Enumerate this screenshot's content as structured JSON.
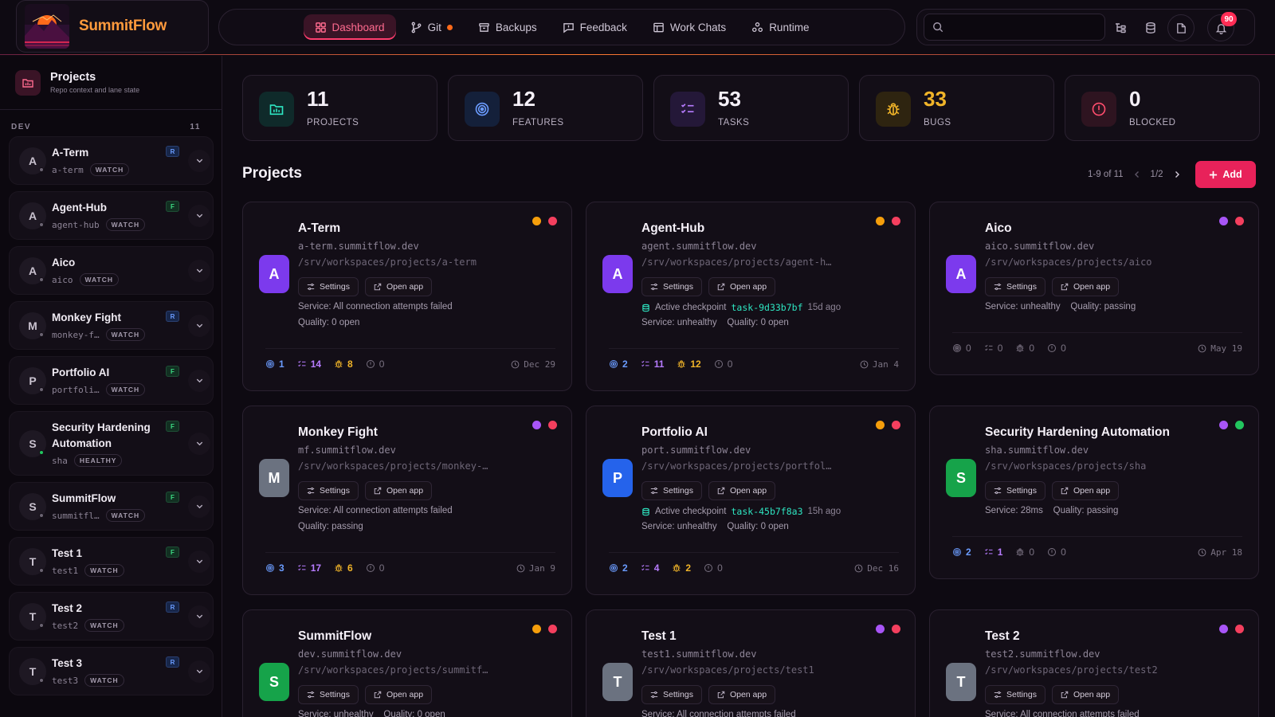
{
  "brand": {
    "name": "SummitFlow"
  },
  "nav": [
    {
      "label": "Dashboard",
      "icon": "grid-icon",
      "active": true
    },
    {
      "label": "Git",
      "icon": "git-branch-icon",
      "indicator": true
    },
    {
      "label": "Backups",
      "icon": "archive-icon"
    },
    {
      "label": "Feedback",
      "icon": "feedback-icon"
    },
    {
      "label": "Work Chats",
      "icon": "table-icon"
    },
    {
      "label": "Runtime",
      "icon": "runtime-icon"
    }
  ],
  "search": {
    "placeholder": ""
  },
  "notifications": {
    "count": "90"
  },
  "sidebar": {
    "title": "Projects",
    "subtitle": "Repo context and lane state",
    "section": {
      "label": "DEV",
      "count": "11"
    },
    "items": [
      {
        "initial": "A",
        "name": "A-Term",
        "slug": "a-term",
        "status": "WATCH",
        "lane": "R",
        "healthy": false
      },
      {
        "initial": "A",
        "name": "Agent-Hub",
        "slug": "agent-hub",
        "status": "WATCH",
        "lane": "F",
        "healthy": false
      },
      {
        "initial": "A",
        "name": "Aico",
        "slug": "aico",
        "status": "WATCH",
        "lane": "",
        "healthy": false
      },
      {
        "initial": "M",
        "name": "Monkey Fight",
        "slug": "monkey-f…",
        "status": "WATCH",
        "lane": "R",
        "healthy": false
      },
      {
        "initial": "P",
        "name": "Portfolio AI",
        "slug": "portfoli…",
        "status": "WATCH",
        "lane": "F",
        "healthy": false
      },
      {
        "initial": "S",
        "name": "Security Hardening Automation",
        "slug": "sha",
        "status": "HEALTHY",
        "lane": "F",
        "healthy": true
      },
      {
        "initial": "S",
        "name": "SummitFlow",
        "slug": "summitfl…",
        "status": "WATCH",
        "lane": "F",
        "healthy": false
      },
      {
        "initial": "T",
        "name": "Test 1",
        "slug": "test1",
        "status": "WATCH",
        "lane": "F",
        "healthy": false
      },
      {
        "initial": "T",
        "name": "Test 2",
        "slug": "test2",
        "status": "WATCH",
        "lane": "R",
        "healthy": false
      },
      {
        "initial": "T",
        "name": "Test 3",
        "slug": "test3",
        "status": "WATCH",
        "lane": "R",
        "healthy": false
      }
    ]
  },
  "stats": [
    {
      "value": "11",
      "label": "PROJECTS",
      "icon": "projects-icon",
      "color": "#2ee6c2",
      "bg": "#0f2a2a"
    },
    {
      "value": "12",
      "label": "FEATURES",
      "icon": "target-icon",
      "color": "#6b9cff",
      "bg": "#14203a"
    },
    {
      "value": "53",
      "label": "TASKS",
      "icon": "checklist-icon",
      "color": "#b77cff",
      "bg": "#241838"
    },
    {
      "value": "33",
      "label": "BUGS",
      "icon": "bug-icon",
      "color": "#f0b429",
      "bg": "#2e2410",
      "valueColor": "#f0b429"
    },
    {
      "value": "0",
      "label": "BLOCKED",
      "icon": "alert-icon",
      "color": "#ff4d6d",
      "bg": "#2e1420"
    }
  ],
  "projects_section": {
    "title": "Projects",
    "range": "1-9 of 11",
    "page": "1/2",
    "add_label": "Add"
  },
  "projects": [
    {
      "name": "A-Term",
      "initial": "A",
      "avatar": "#7c3aed",
      "domain": "a-term.summitflow.dev",
      "path": "/srv/workspaces/projects/a-term",
      "line1": "Service: All connection attempts failed",
      "line2": "Quality: 0 open",
      "features": "1",
      "tasks": "14",
      "bugs": "8",
      "blocked": "0",
      "date": "Dec 29",
      "dots": [
        "#f59e0b",
        "#f43f5e"
      ]
    },
    {
      "name": "Agent-Hub",
      "initial": "A",
      "avatar": "#7c3aed",
      "domain": "agent.summitflow.dev",
      "path": "/srv/workspaces/projects/agent-h…",
      "checkpoint": {
        "label": "Active checkpoint",
        "id": "task-9d33b7bf",
        "age": "15d ago"
      },
      "line2": "Service: unhealthy    Quality: 0 open",
      "features": "2",
      "tasks": "11",
      "bugs": "12",
      "blocked": "0",
      "date": "Jan 4",
      "dots": [
        "#f59e0b",
        "#f43f5e"
      ]
    },
    {
      "name": "Aico",
      "initial": "A",
      "avatar": "#7c3aed",
      "domain": "aico.summitflow.dev",
      "path": "/srv/workspaces/projects/aico",
      "line1": "Service: unhealthy    Quality: passing",
      "features": "0",
      "tasks": "0",
      "bugs": "0",
      "blocked": "0",
      "date": "May 19",
      "dots": [
        "#a855f7",
        "#f43f5e"
      ]
    },
    {
      "name": "Monkey Fight",
      "initial": "M",
      "avatar": "#6b7280",
      "domain": "mf.summitflow.dev",
      "path": "/srv/workspaces/projects/monkey-…",
      "line1": "Service: All connection attempts failed",
      "line2": "Quality: passing",
      "features": "3",
      "tasks": "17",
      "bugs": "6",
      "blocked": "0",
      "date": "Jan 9",
      "dots": [
        "#a855f7",
        "#f43f5e"
      ]
    },
    {
      "name": "Portfolio AI",
      "initial": "P",
      "avatar": "#2563eb",
      "domain": "port.summitflow.dev",
      "path": "/srv/workspaces/projects/portfol…",
      "checkpoint": {
        "label": "Active checkpoint",
        "id": "task-45b7f8a3",
        "age": "15h ago"
      },
      "line2": "Service: unhealthy    Quality: 0 open",
      "features": "2",
      "tasks": "4",
      "bugs": "2",
      "blocked": "0",
      "date": "Dec 16",
      "dots": [
        "#f59e0b",
        "#f43f5e"
      ]
    },
    {
      "name": "Security Hardening Automation",
      "initial": "S",
      "avatar": "#16a34a",
      "domain": "sha.summitflow.dev",
      "path": "/srv/workspaces/projects/sha",
      "line1": "Service: 28ms    Quality: passing",
      "features": "2",
      "tasks": "1",
      "bugs": "0",
      "blocked": "0",
      "date": "Apr 18",
      "dots": [
        "#a855f7",
        "#22c55e"
      ]
    },
    {
      "name": "SummitFlow",
      "initial": "S",
      "avatar": "#16a34a",
      "domain": "dev.summitflow.dev",
      "path": "/srv/workspaces/projects/summitf…",
      "line1": "Service: unhealthy    Quality: 0 open",
      "dots": [
        "#f59e0b",
        "#f43f5e"
      ]
    },
    {
      "name": "Test 1",
      "initial": "T",
      "avatar": "#6b7280",
      "domain": "test1.summitflow.dev",
      "path": "/srv/workspaces/projects/test1",
      "line1": "Service: All connection attempts failed",
      "dots": [
        "#a855f7",
        "#f43f5e"
      ]
    },
    {
      "name": "Test 2",
      "initial": "T",
      "avatar": "#6b7280",
      "domain": "test2.summitflow.dev",
      "path": "/srv/workspaces/projects/test2",
      "line1": "Service: All connection attempts failed",
      "dots": [
        "#a855f7",
        "#f43f5e"
      ]
    }
  ],
  "buttons": {
    "settings": "Settings",
    "open_app": "Open app"
  }
}
